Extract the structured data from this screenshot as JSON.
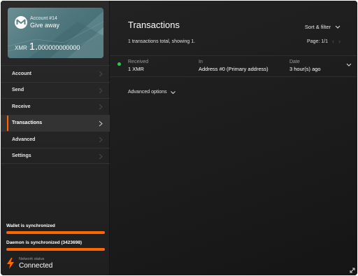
{
  "account_card": {
    "account_number": "Account #14",
    "account_name": "Give away",
    "currency": "XMR",
    "balance_int": "1.",
    "balance_dec": "000000000000"
  },
  "menu": {
    "items": [
      {
        "label": "Account"
      },
      {
        "label": "Send"
      },
      {
        "label": "Receive"
      },
      {
        "label": "Transactions"
      },
      {
        "label": "Advanced"
      },
      {
        "label": "Settings"
      }
    ]
  },
  "status": {
    "wallet_sync": "Wallet is synchronized",
    "daemon_sync": "Daemon is synchronized (3423698)",
    "network_label": "Network status",
    "network_value": "Connected"
  },
  "main": {
    "title": "Transactions",
    "sort_label": "Sort & filter",
    "summary": "1 transactions total, showing 1.",
    "page_label": "Page: 1/1",
    "transactions": [
      {
        "direction_label": "Received",
        "amount": "1 XMR",
        "in_label": "In",
        "in_value": "Address #0 (Primary address)",
        "date_label": "Date",
        "date_value": "3 hour(s) ago"
      }
    ],
    "advanced_options": "Advanced options"
  },
  "colors": {
    "accent": "#ff6600",
    "received_dot": "#2dc84d",
    "card_teal": "#5b8389"
  },
  "icons": [
    "monero-logo-icon",
    "chevron-right-icon",
    "chevron-down-icon",
    "lightning-icon",
    "resize-icon"
  ]
}
